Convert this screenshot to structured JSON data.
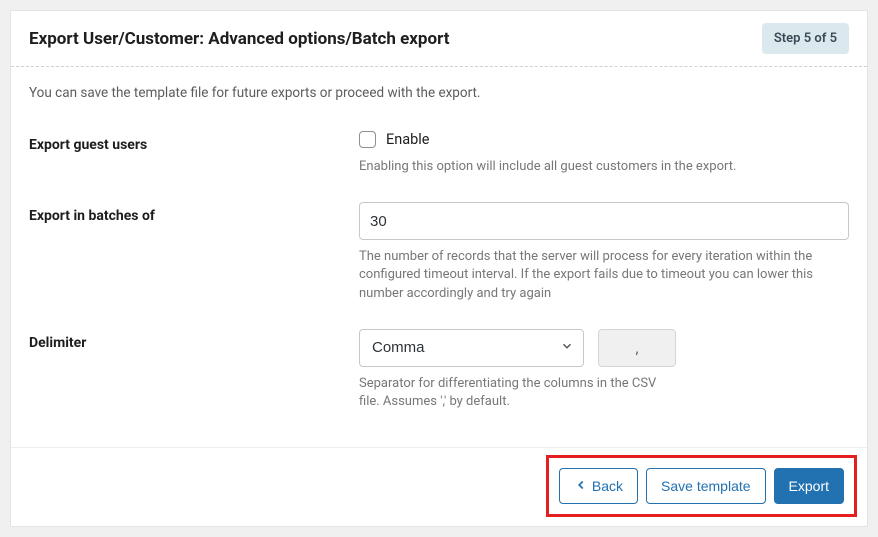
{
  "header": {
    "title": "Export User/Customer: Advanced options/Batch export",
    "step_badge": "Step 5 of 5"
  },
  "intro": "You can save the template file for future exports or proceed with the export.",
  "fields": {
    "guest_users": {
      "label": "Export guest users",
      "checkbox_label": "Enable",
      "help": "Enabling this option will include all guest customers in the export."
    },
    "batch": {
      "label": "Export in batches of",
      "value": "30",
      "help": "The number of records that the server will process for every iteration within the configured timeout interval. If the export fails due to timeout you can lower this number accordingly and try again"
    },
    "delimiter": {
      "label": "Delimiter",
      "selected": "Comma",
      "char": ",",
      "help": "Separator for differentiating the columns in the CSV file. Assumes ',' by default."
    }
  },
  "footer": {
    "back": "Back",
    "save_template": "Save template",
    "export": "Export"
  }
}
